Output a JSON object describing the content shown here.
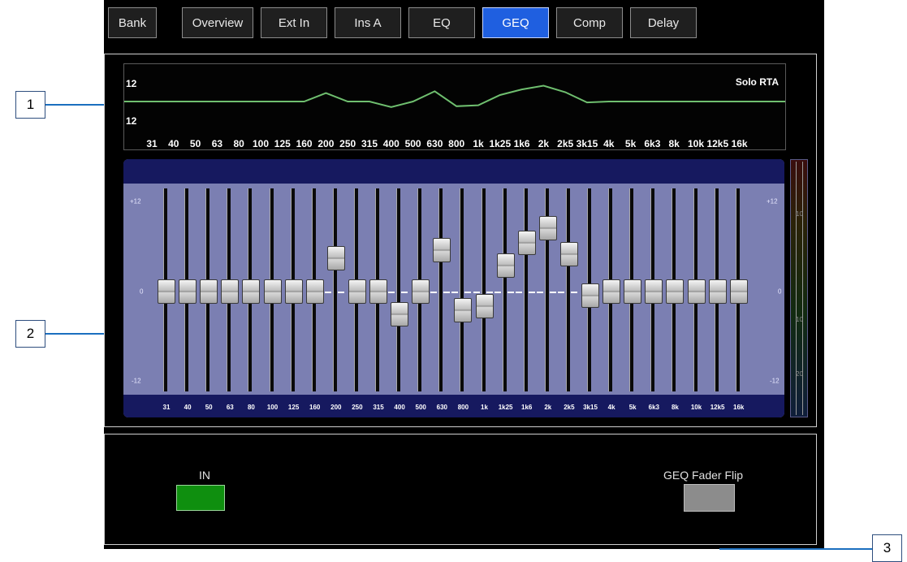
{
  "tabs": [
    {
      "label": "Bank",
      "active": false
    },
    {
      "label": "Overview",
      "active": false
    },
    {
      "label": "Ext In",
      "active": false
    },
    {
      "label": "Ins A",
      "active": false
    },
    {
      "label": "EQ",
      "active": false
    },
    {
      "label": "GEQ",
      "active": true
    },
    {
      "label": "Comp",
      "active": false
    },
    {
      "label": "Delay",
      "active": false
    }
  ],
  "rta": {
    "title": "Solo RTA",
    "top_label": "12",
    "bottom_label": "12",
    "frequencies": [
      "31",
      "40",
      "50",
      "63",
      "80",
      "100",
      "125",
      "160",
      "200",
      "250",
      "315",
      "400",
      "500",
      "630",
      "800",
      "1k",
      "1k25",
      "1k6",
      "2k",
      "2k5",
      "3k15",
      "4k",
      "5k",
      "6k3",
      "8k",
      "10k",
      "12k5",
      "16k"
    ],
    "curve_color": "#6fbf6f"
  },
  "geq": {
    "scale_top": "+12",
    "scale_mid": "0",
    "scale_bottom": "-12",
    "frequencies": [
      "31",
      "40",
      "50",
      "63",
      "80",
      "100",
      "125",
      "160",
      "200",
      "250",
      "315",
      "400",
      "500",
      "630",
      "800",
      "1k",
      "1k25",
      "1k6",
      "2k",
      "2k5",
      "3k15",
      "4k",
      "5k",
      "6k3",
      "8k",
      "10k",
      "12k5",
      "16k"
    ],
    "gains_db": [
      0,
      0,
      0,
      0,
      0,
      0,
      0,
      0,
      4.5,
      0,
      0,
      -3,
      0,
      5.5,
      -2.5,
      -2,
      3.5,
      6.5,
      8.5,
      5,
      -0.5,
      0,
      0,
      0,
      0,
      0,
      0,
      0
    ]
  },
  "meter": {
    "labels": [
      "10",
      "10",
      "20"
    ]
  },
  "controls": {
    "in_label": "IN",
    "in_color": "#0f8f0f",
    "flip_label": "GEQ Fader Flip",
    "flip_color": "#8c8c8c"
  },
  "callouts": [
    "1",
    "2",
    "3"
  ],
  "accent_color": "#1f5fe0"
}
